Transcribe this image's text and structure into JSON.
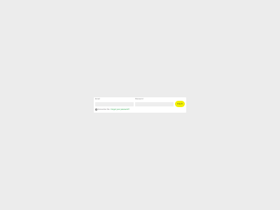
{
  "login_form": {
    "email_label": "Email",
    "email_value": "",
    "password_label": "Password",
    "password_value": "",
    "submit_label": "Log in",
    "remember_label": "Remember Me",
    "remember_checked": false,
    "forgot_label": "Forgot your password?"
  },
  "colors": {
    "background": "#ececec",
    "card": "#ffffff",
    "input_background": "#eeeeee",
    "button": "#f2f000",
    "link": "#2fa84f"
  }
}
